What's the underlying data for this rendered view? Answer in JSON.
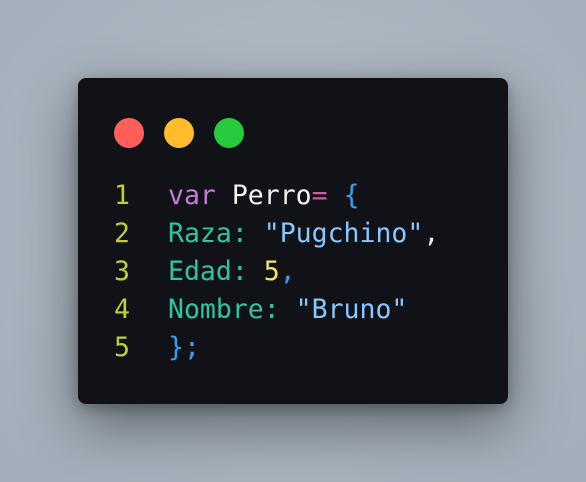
{
  "colors": {
    "window_bg": "#111217",
    "line_number": "#c3cc38",
    "keyword": "#c678dd",
    "identifier": "#f2f2f2",
    "operator": "#e052a4",
    "brace": "#3d9ee8",
    "property": "#2ec4a4",
    "string": "#8ac6ff",
    "number": "#f5e663",
    "punct_teal": "#2ec4a4",
    "punct_white": "#e6e6e6",
    "punct_blue": "#3d9ee8"
  },
  "window_controls": [
    {
      "name": "close",
      "color": "#ff5f5a"
    },
    {
      "name": "minimize",
      "color": "#ffbd2e"
    },
    {
      "name": "maximize",
      "color": "#27c93f"
    }
  ],
  "code": {
    "lines": [
      {
        "number": "1",
        "tokens": [
          {
            "text": "var",
            "kind": "keyword"
          },
          {
            "text": " ",
            "kind": "space"
          },
          {
            "text": "Perro",
            "kind": "identifier"
          },
          {
            "text": "=",
            "kind": "operator"
          },
          {
            "text": " ",
            "kind": "space"
          },
          {
            "text": "{",
            "kind": "brace"
          }
        ]
      },
      {
        "number": "2",
        "tokens": [
          {
            "text": "Raza",
            "kind": "property"
          },
          {
            "text": ":",
            "kind": "punct_teal"
          },
          {
            "text": " ",
            "kind": "space"
          },
          {
            "text": "\"Pugchino\"",
            "kind": "string"
          },
          {
            "text": ",",
            "kind": "punct_white"
          }
        ]
      },
      {
        "number": "3",
        "tokens": [
          {
            "text": "Edad",
            "kind": "property"
          },
          {
            "text": ":",
            "kind": "punct_teal"
          },
          {
            "text": " ",
            "kind": "space"
          },
          {
            "text": "5",
            "kind": "number"
          },
          {
            "text": ",",
            "kind": "punct_blue"
          }
        ]
      },
      {
        "number": "4",
        "tokens": [
          {
            "text": "Nombre",
            "kind": "property"
          },
          {
            "text": ":",
            "kind": "punct_teal"
          },
          {
            "text": " ",
            "kind": "space"
          },
          {
            "text": "\"Bruno\"",
            "kind": "string"
          }
        ]
      },
      {
        "number": "5",
        "tokens": [
          {
            "text": "};",
            "kind": "brace"
          }
        ]
      }
    ]
  }
}
